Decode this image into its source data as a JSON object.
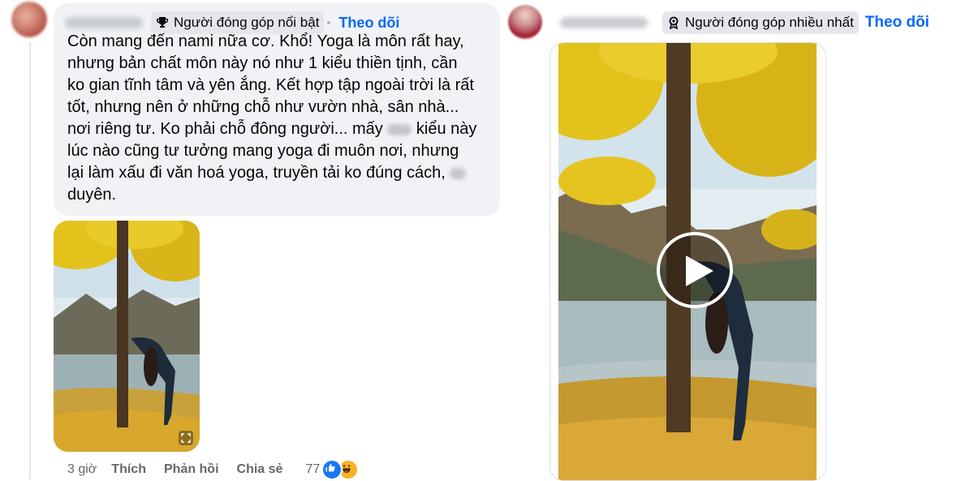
{
  "left_comment": {
    "author_name_blurred": "Thùy Anh",
    "badge": "Người đóng góp nổi bật",
    "follow_label": "Theo dõi",
    "lines": [
      "Còn mang đến nami nữa cơ. Khổ! Yoga là môn rất hay,",
      "nhưng bản chất môn này nó như 1 kiểu thiền tịnh, cần",
      "ko gian tĩnh tâm và yên ắng. Kết hợp tập ngoài trời là rất",
      "tốt, nhưng nên ở những chỗ như vườn nhà, sân nhà...",
      "nơi riêng tư. Ko phải chỗ đông người... mấy",
      "kiểu này",
      "lúc nào cũng tư tưởng mang yoga đi muôn nơi, nhưng",
      "lại làm xấu đi văn hoá yoga, truyền tải ko đúng cách,",
      "duyên."
    ],
    "actions": {
      "time": "3 giờ",
      "like": "Thích",
      "reply": "Phản hồi",
      "share": "Chia sẻ",
      "reaction_count": "77"
    }
  },
  "right_comment": {
    "author_name_blurred": "Trịnh Cường",
    "badge": "Người đóng góp nhiều nhất",
    "follow_label": "Theo dõi"
  },
  "icons": {
    "badge_left": "trophy-icon",
    "badge_right": "medal-icon",
    "video": "play-icon",
    "thumb": "expand-icon",
    "reactions": [
      "like-icon",
      "haha-icon"
    ]
  },
  "colors": {
    "link": "#0866ff",
    "bubble": "#f0f2f5",
    "muted": "#65676b",
    "like": "#1877f2",
    "haha": "#f7b125"
  }
}
